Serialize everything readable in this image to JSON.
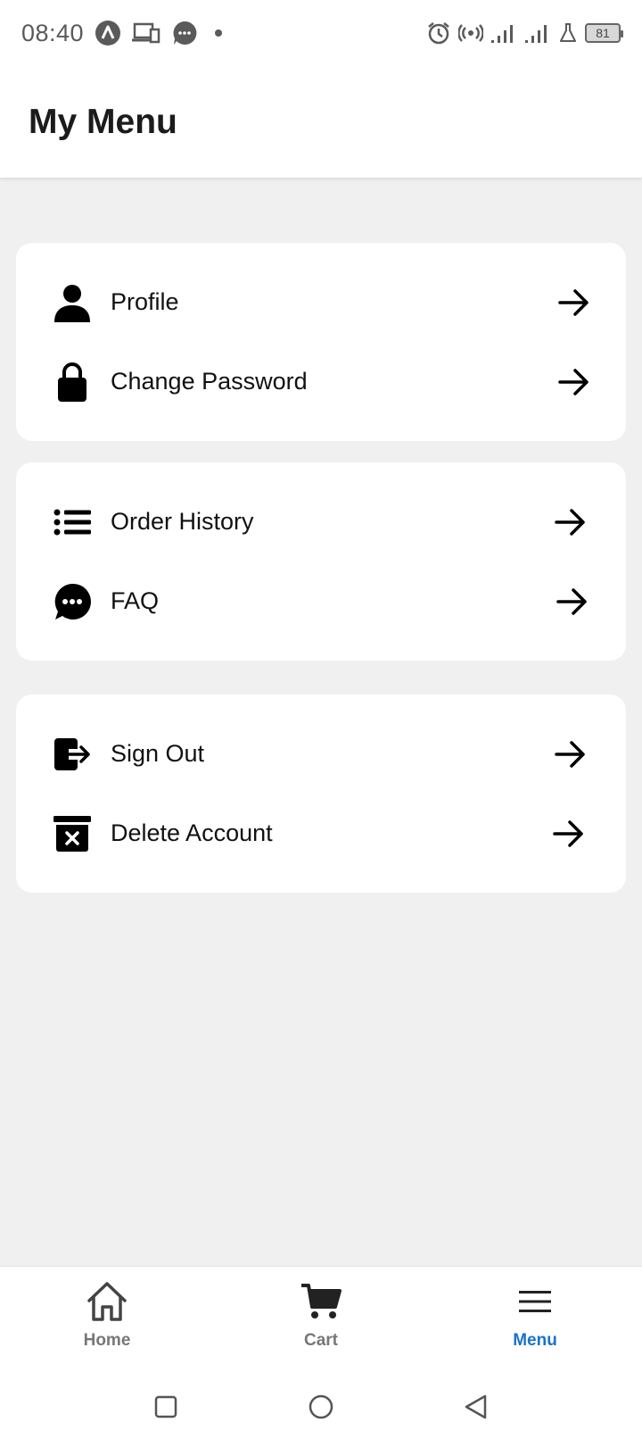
{
  "status_bar": {
    "time": "08:40",
    "battery": "81",
    "left_icons": [
      "a-badge-icon",
      "devices-icon",
      "chat-bubble-icon",
      "dot-icon"
    ],
    "right_icons": [
      "alarm-icon",
      "hotspot-icon",
      "signal-icon",
      "signal-icon",
      "flask-icon",
      "battery-icon"
    ]
  },
  "app_bar": {
    "title": "My Menu"
  },
  "sections": [
    {
      "items": [
        {
          "label": "Profile",
          "icon": "person-icon"
        },
        {
          "label": "Change Password",
          "icon": "lock-icon"
        }
      ]
    },
    {
      "items": [
        {
          "label": "Order History",
          "icon": "list-icon"
        },
        {
          "label": "FAQ",
          "icon": "chat-dots-icon"
        }
      ]
    },
    {
      "items": [
        {
          "label": "Sign Out",
          "icon": "sign-out-icon"
        },
        {
          "label": "Delete Account",
          "icon": "trash-x-icon"
        }
      ]
    }
  ],
  "bottom_nav": {
    "items": [
      {
        "label": "Home",
        "icon": "home-icon",
        "active": false
      },
      {
        "label": "Cart",
        "icon": "cart-icon",
        "active": false
      },
      {
        "label": "Menu",
        "icon": "hamburger-icon",
        "active": true
      }
    ]
  },
  "colors": {
    "accent": "#1a73c9",
    "background": "#f0f0f0",
    "card": "#ffffff",
    "inactive_nav": "#777777"
  },
  "system_nav": [
    "square-icon",
    "circle-icon",
    "back-triangle-icon"
  ]
}
